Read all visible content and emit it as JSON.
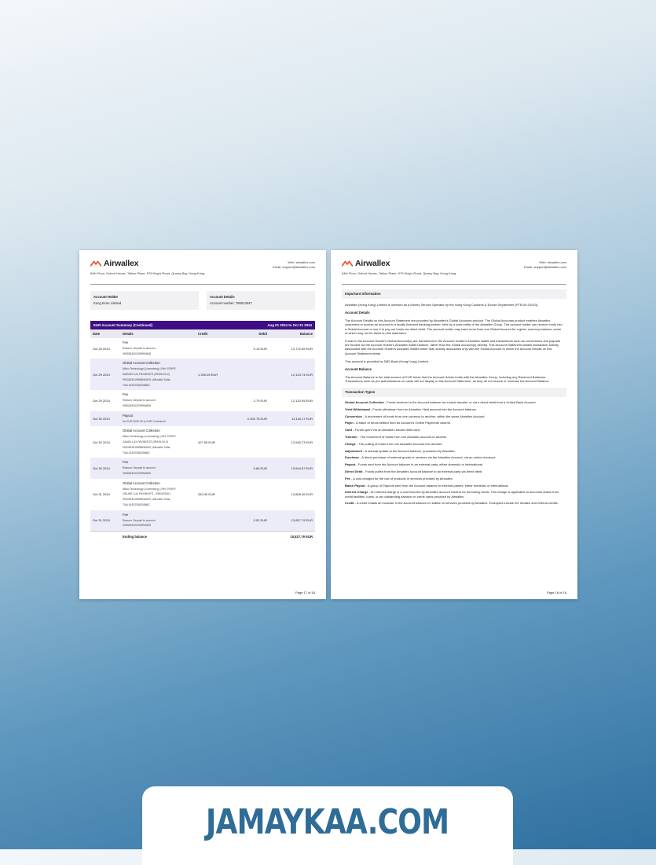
{
  "brand": {
    "name": "Airwallex",
    "accent": "#e8542c"
  },
  "header": {
    "address": "54th Floor, Oxford House, Taikoo Place, 979 King's Road, Quarry Bay, Hong Kong",
    "web": "Web: airwallex.com",
    "email": "Email: support@airwallex.com"
  },
  "left_page": {
    "account_holder_label": "Account Holder",
    "account_holder_value": "Kong Econ Limited",
    "account_details_label": "Account Details",
    "account_number": "Account number: 795013347",
    "summary_title": "EUR Account Summary (Continued)",
    "summary_period": "Aug 01 2024 to Oct 31 2024",
    "summary_color": "#3d0e85",
    "columns": [
      "Date",
      "Details",
      "Credit",
      "Debit",
      "Balance"
    ],
    "rows": [
      {
        "date": "Oct 28 2024",
        "lines": [
          "Fee",
          "Reason: Deposit to account",
          "0983283002039994808"
        ],
        "credit": "",
        "debit": "0.15 EUR",
        "balance": "13,722.69 EUR"
      },
      {
        "date": "Oct 29 2024",
        "lines": [
          "Global Account Collection",
          "Nikko Technology (Luxemburg) | Ref: 979IPE",
          "MARAM LUX PAYMENTS (99928-00-0)",
          "9930283019898940849 | Affroditiv Softa",
          "TNA-9183753603588C"
        ],
        "credit": "1,395.05 EUR",
        "debit": "",
        "balance": "12,123.74 EUR"
      },
      {
        "date": "Oct 29 2024",
        "lines": [
          "Fee",
          "Reason: Deposit to account",
          "0983283002039994808"
        ],
        "credit": "",
        "debit": "2.79 EUR",
        "balance": "12,120.95 EUR"
      },
      {
        "date": "Oct 30 2024",
        "lines": [
          "Payout",
          "No EUR 0000.09 to EUR Commerce"
        ],
        "credit": "",
        "debit": "2,000.78 EUR",
        "balance": "13,118.17 EUR"
      },
      {
        "date": "Oct 30 2024",
        "lines": [
          "Global Account Collection",
          "Nikko Technology (Luxemburg) | Ref: 979IPE",
          "ZAVAN LUX PAYMENTS (99928-00-0)",
          "9930283019898940849 | Affroditiv Softa",
          "TNA-9183753603588C"
        ],
        "credit": "427.55 EUR",
        "debit": "",
        "balance": "13,545.73 EUR"
      },
      {
        "date": "Oct 30 2024",
        "lines": [
          "Fee",
          "Reason: Deposit to account",
          "0983283002039994808"
        ],
        "credit": "",
        "debit": "0.86 EUR",
        "balance": "13,544.87 EUR"
      },
      {
        "date": "Oct 31 2024",
        "lines": [
          "Global Account Collection",
          "Nikko Technology (Luxemburg) | Ref: 979IPE",
          "ONLINE LUX PAYMENTS - 0983292301",
          "9930283019898940849 | Affroditiv Softa",
          "TNA-9183753603588C"
        ],
        "credit": "283.49 EUR",
        "debit": "",
        "balance": "13,828.36 EUR"
      },
      {
        "date": "Oct 31 2024",
        "lines": [
          "Fee",
          "Reason: Deposit to account",
          "0983283002039994808"
        ],
        "credit": "",
        "debit": "0.52 EUR",
        "balance": "13,827.79 EUR"
      }
    ],
    "ending_label": "Ending balance",
    "ending_value": "10,827.79 EUR",
    "page": "Page 17 of 18"
  },
  "right_page": {
    "important_title": "Important Information",
    "intro": "Airwallex (Hong Kong) Limited is licensed as a Money Service Operator by the Hong Kong Customs & Excise Department (PTB-09-01923).",
    "acct_details_title": "Account Details",
    "acct_details_p1": "The Account Details on this Account Statement are provided by Airwallex's Global Accounts product. The Global Accounts product enables Airwallex customers to access an account at a locally licensed banking partner, held by a local entity of the Airwallex Group. The account holder can receive funds into a Global Account or use it to pay out funds via direct debit. The account holder may have more than one Global Account for a given currency balance, some of which may not be listed on this statement.",
    "acct_details_p2": "Funds in the Account Holder's Global Account(s) are transferred to the Account Holder's Airwallex wallet and transactions such as conversions and payouts are funded via the Account Holder's Airwallex wallet balance, rather than the Global Account(s) directly. This Account Statement details transaction activity associated with the Account Holder's Airwallex Wallet rather than activity associated only with the Global Account to which the Account Details on this Account Statement relate.",
    "acct_details_p3": "This account is provided by DBS Bank (Hong Kong) Limited.",
    "balance_title": "Account Balance",
    "balance_p": "The Account Balance is the total amount of EUR funds that the Account Holder holds with the Airwallex Group, including any Reserved Balances. Transactions such as pre-authorisations on cards will not display in this Account Statement, as they do not reduce or increase the Account Balance.",
    "types_title": "Transaction Types",
    "types": [
      {
        "term": "Global Account Collection",
        "desc": " - Funds received in the Account balance via a bank transfer, or via a direct debit from a United Bank Account."
      },
      {
        "term": "Yield Withdrawal",
        "desc": " - Funds withdrawn from an Airwallex Yield account into the Account balance."
      },
      {
        "term": "Conversion",
        "desc": " - A movement of funds from one currency to another, within the same Airwallex Account."
      },
      {
        "term": "Payin",
        "desc": " - A batch of funds settled from an Account's Online Payments volume."
      },
      {
        "term": "Card",
        "desc": " - Funds spent via an Airwallex-issued debit card."
      },
      {
        "term": "Transfer",
        "desc": " - The movement of funds from one Airwallex account to another."
      },
      {
        "term": "Charge",
        "desc": " - The pulling of funds from one Airwallex Account into another."
      },
      {
        "term": "Adjustment",
        "desc": " - A manual update to the Account balance, processed by Airwallex."
      },
      {
        "term": "Purchase",
        "desc": " - A direct purchase of external goods or services via the Airwallex Account, via an online checkout."
      },
      {
        "term": "Payout",
        "desc": " - Funds sent from the Account balance to an external party, either domestic or international."
      },
      {
        "term": "Direct Debit",
        "desc": " - Funds pulled from the Airwallex Account balance to an external party via direct debit."
      },
      {
        "term": "Fee",
        "desc": " - A cost charged for the use of products or services provided by Airwallex."
      },
      {
        "term": "Batch Payout",
        "desc": " - A group of Payouts sent from the Account balance to external parties, either domestic or international."
      },
      {
        "term": "Interest Charge",
        "desc": " - An interest charge is a cost incurred by Airwallex account holders for borrowing funds. This charge is applicable to accounts drawn from credit facilities, loans, or an outstanding balance on credit cards provided by Airwallex."
      },
      {
        "term": "Credit",
        "desc": " - A credit entails an increase in the Account balance in relation to services provided by Airwallex. Examples include fee rebates and referral credits."
      }
    ],
    "page": "Page 18 of 18"
  },
  "footer": {
    "text": "JAMAYKAA.COM",
    "color": "#2f6c96"
  }
}
